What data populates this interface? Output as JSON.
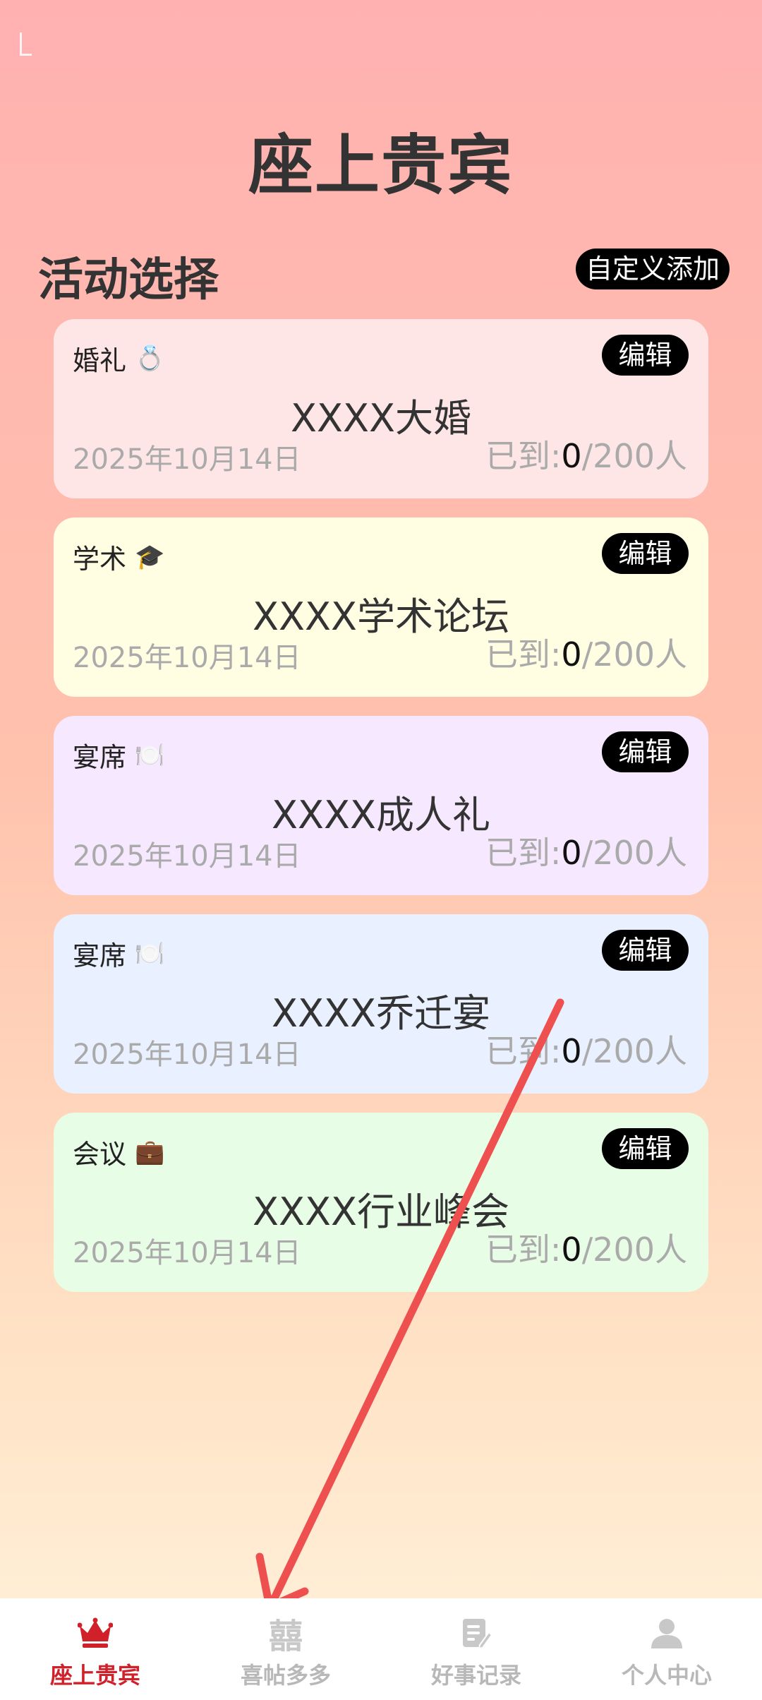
{
  "app": {
    "title": "座上贵宾"
  },
  "section": {
    "title": "活动选择",
    "custom_add_label": "自定义添加"
  },
  "events": [
    {
      "type": "婚礼",
      "emoji": "💍",
      "edit_label": "编辑",
      "name": "XXXX大婚",
      "date": "2025年10月14日",
      "checkin_prefix": "已到:",
      "arrived": "0",
      "capacity_suffix": "/200人",
      "bg": "#ffe6e6"
    },
    {
      "type": "学术",
      "emoji": "🎓",
      "edit_label": "编辑",
      "name": "XXXX学术论坛",
      "date": "2025年10月14日",
      "checkin_prefix": "已到:",
      "arrived": "0",
      "capacity_suffix": "/200人",
      "bg": "#fffde2"
    },
    {
      "type": "宴席",
      "emoji": "🍽️",
      "edit_label": "编辑",
      "name": "XXXX成人礼",
      "date": "2025年10月14日",
      "checkin_prefix": "已到:",
      "arrived": "0",
      "capacity_suffix": "/200人",
      "bg": "#f6e8ff"
    },
    {
      "type": "宴席",
      "emoji": "🍽️",
      "edit_label": "编辑",
      "name": "XXXX乔迁宴",
      "date": "2025年10月14日",
      "checkin_prefix": "已到:",
      "arrived": "0",
      "capacity_suffix": "/200人",
      "bg": "#e9f0ff"
    },
    {
      "type": "会议",
      "emoji": "💼",
      "edit_label": "编辑",
      "name": "XXXX行业峰会",
      "date": "2025年10月14日",
      "checkin_prefix": "已到:",
      "arrived": "0",
      "capacity_suffix": "/200人",
      "bg": "#e8fde6"
    }
  ],
  "tabs": [
    {
      "label": "座上贵宾",
      "icon": "crown-icon",
      "active": true
    },
    {
      "label": "喜帖多多",
      "icon": "double-happiness-icon",
      "glyph": "囍",
      "active": false
    },
    {
      "label": "好事记录",
      "icon": "note-icon",
      "active": false
    },
    {
      "label": "个人中心",
      "icon": "person-icon",
      "active": false
    }
  ],
  "colors": {
    "active_tab": "#d0202a",
    "inactive_tab": "#b8b8b8",
    "annotation_arrow": "#ee5050"
  }
}
